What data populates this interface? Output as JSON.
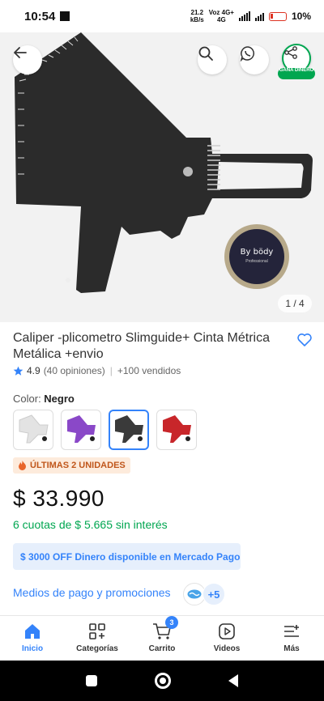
{
  "status_bar": {
    "time": "10:54",
    "net_speed": "21.2",
    "net_unit": "kB/s",
    "carrier_top": "Voz 4G+",
    "carrier_bottom": "4G",
    "battery": "10%"
  },
  "gallery": {
    "counter": "1 / 4",
    "share_badge": "GANA DINERO",
    "tape_brand": "By bödy",
    "tape_sub": "Professional"
  },
  "product": {
    "title": "Caliper -plicometro Slimguide+ Cinta Métrica Metálica +envio",
    "rating": "4.9",
    "reviews": "(40 opiniones)",
    "sold": "+100 vendidos",
    "color_prefix": "Color: ",
    "color_value": "Negro",
    "stock_badge": "ÚLTIMAS 2 UNIDADES",
    "price": "$ 33.990",
    "installments": "6 cuotas de $ 5.665 sin interés",
    "promo": "$ 3000 OFF Dinero disponible en Mercado Pago",
    "payment_link": "Medios de pago y promociones",
    "payment_more": "+5"
  },
  "swatches": [
    {
      "color": "#e9e9e9",
      "name": "white"
    },
    {
      "color": "#8a48c8",
      "name": "purple"
    },
    {
      "color": "#3a3a3a",
      "name": "black"
    },
    {
      "color": "#c8262a",
      "name": "red"
    }
  ],
  "bottom_nav": {
    "items": [
      {
        "label": "Inicio"
      },
      {
        "label": "Categorías"
      },
      {
        "label": "Carrito",
        "badge": "3"
      },
      {
        "label": "Videos"
      },
      {
        "label": "Más"
      }
    ]
  },
  "colors": {
    "accent": "#3483fa",
    "success": "#00a650",
    "badge_text": "#c0561b"
  }
}
